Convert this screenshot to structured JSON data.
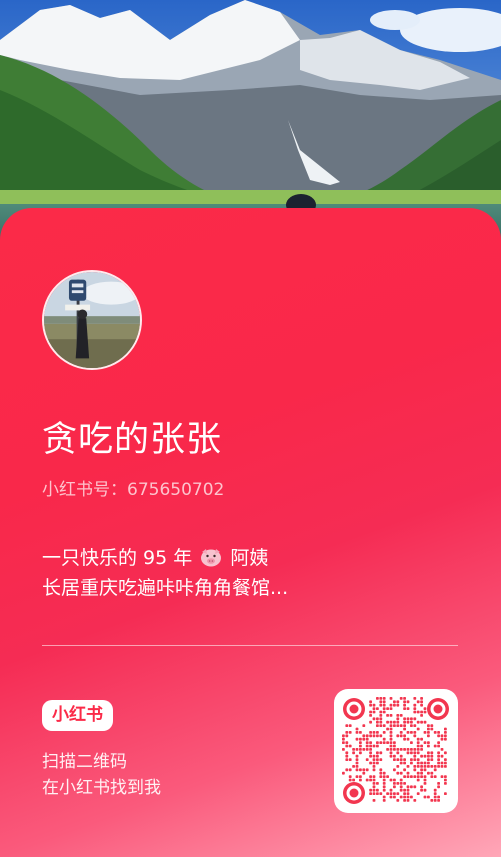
{
  "profile": {
    "nickname": "贪吃的张张",
    "account_id": "小红书号：675650702",
    "bio_line1_a": "一只快乐的 95 年",
    "bio_line1_emoji": "pig-face-emoji",
    "bio_line1_b": "阿姨",
    "bio_line2": "长居重庆吃遍咔咔角角餐馆..."
  },
  "footer": {
    "brand": "小红书",
    "scan_line1": "扫描二维码",
    "scan_line2": "在小红书找到我"
  },
  "colors": {
    "card_top": "#fb2a48",
    "card_bottom": "#ffa7b8",
    "qr_accent": "#f2364f"
  },
  "icons": {
    "qr": "qr-code-icon",
    "avatar": "avatar-photo"
  }
}
